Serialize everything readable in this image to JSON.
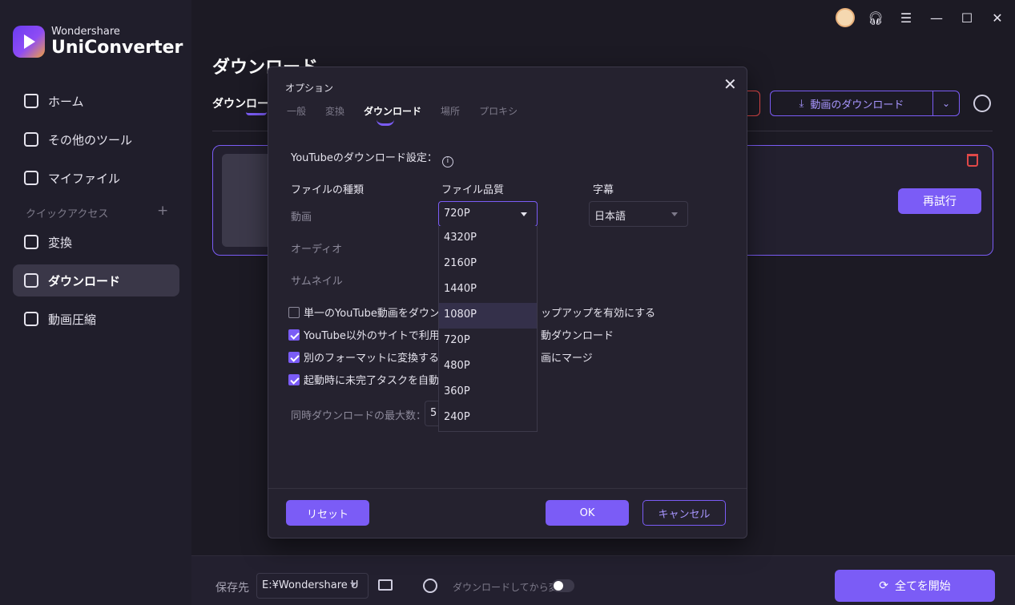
{
  "app": {
    "brand": "Wondershare",
    "product": "UniConverter"
  },
  "sidebar": {
    "items": [
      {
        "label": "ホーム",
        "icon": "home-icon"
      },
      {
        "label": "その他のツール",
        "icon": "toolbox-icon"
      },
      {
        "label": "マイファイル",
        "icon": "file-icon"
      }
    ],
    "quick_access_label": "クイックアクセス",
    "quick_access_plus": "+",
    "quick_items": [
      {
        "label": "変換",
        "icon": "convert-icon"
      },
      {
        "label": "ダウンロード",
        "icon": "download-icon",
        "active": true
      },
      {
        "label": "動画圧縮",
        "icon": "compress-icon"
      }
    ]
  },
  "main": {
    "title": "ダウンロード",
    "sub_tab": "ダウンロード",
    "download_button": "動画のダウンロード",
    "retry_button": "再試行"
  },
  "bottom": {
    "save_label": "保存先",
    "save_path": "E:¥Wondershare U",
    "convert_after_label": "ダウンロードしてから変換:",
    "start_all": "全てを開始"
  },
  "dialog": {
    "title": "オプション",
    "close": "✕",
    "tabs": [
      "一般",
      "変換",
      "ダウンロード",
      "場所",
      "プロキシ"
    ],
    "active_tab": "ダウンロード",
    "youtube_settings": "YouTubeのダウンロード設定：",
    "col_type": "ファイルの種類",
    "col_quality": "ファイル品質",
    "col_subtitle": "字幕",
    "rows": [
      "動画",
      "オーディオ",
      "サムネイル"
    ],
    "quality_value": "720P",
    "subtitle_value": "日本語",
    "quality_options": [
      "4320P",
      "2160P",
      "1440P",
      "1080P",
      "720P",
      "480P",
      "360P",
      "240P"
    ],
    "hovered_option": "1080P",
    "checkboxes": [
      {
        "before": "単一のYouTube動画をダウンロ",
        "after": "ップアップを有効にする",
        "checked": false
      },
      {
        "before": "YouTube以外のサイトで利用可",
        "after": "動ダウンロード",
        "checked": true
      },
      {
        "before": "別のフォーマットに変換するとき",
        "after": "画にマージ",
        "checked": true
      },
      {
        "before": "起動時に未完了タスクを自動",
        "after": "",
        "checked": true
      }
    ],
    "max_label": "同時ダウンロードの最大数：",
    "max_value": "5",
    "reset": "リセット",
    "ok": "OK",
    "cancel": "キャンセル"
  },
  "colors": {
    "accent": "#7b5cf6",
    "danger": "#e04848",
    "background": "#1c1a24"
  }
}
